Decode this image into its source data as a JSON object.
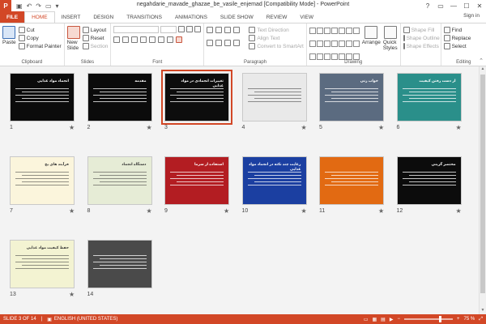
{
  "app": {
    "logo": "P",
    "title": "negahdarie_mavade_ghazae_be_vasile_enjemad [Compatibility Mode] - PowerPoint",
    "window_controls": [
      "?",
      "▭",
      "—",
      "☐",
      "✕"
    ],
    "sign_in": "Sign in"
  },
  "tabs": [
    {
      "label": "FILE"
    },
    {
      "label": "HOME"
    },
    {
      "label": "INSERT"
    },
    {
      "label": "DESIGN"
    },
    {
      "label": "TRANSITIONS"
    },
    {
      "label": "ANIMATIONS"
    },
    {
      "label": "SLIDE SHOW"
    },
    {
      "label": "REVIEW"
    },
    {
      "label": "VIEW"
    }
  ],
  "ribbon": {
    "clipboard": {
      "label": "Clipboard",
      "paste": "Paste",
      "cut": "Cut",
      "copy": "Copy",
      "format_painter": "Format Painter"
    },
    "slides": {
      "label": "Slides",
      "new_slide": "New Slide",
      "layout": "Layout",
      "reset": "Reset",
      "section": "Section"
    },
    "font": {
      "label": "Font"
    },
    "paragraph": {
      "label": "Paragraph",
      "text_direction": "Text Direction",
      "align_text": "Align Text",
      "convert": "Convert to SmartArt"
    },
    "drawing": {
      "label": "Drawing",
      "arrange": "Arrange",
      "quick_styles": "Quick Styles",
      "shape_fill": "Shape Fill",
      "shape_outline": "Shape Outline",
      "shape_effects": "Shape Effects"
    },
    "editing": {
      "label": "Editing",
      "find": "Find",
      "replace": "Replace",
      "select": "Select"
    }
  },
  "slides": [
    {
      "num": "1",
      "title": "انجماد مواد غذایی",
      "bg": "#0b0b0b",
      "star": "★"
    },
    {
      "num": "2",
      "title": "مقدمه",
      "bg": "#0b0b0b",
      "star": "★"
    },
    {
      "num": "3",
      "title": "تغییرات انجمادی در مواد غذایی",
      "bg": "#0d0d0d",
      "star": ""
    },
    {
      "num": "4",
      "title": "",
      "bg": "#e9e9e9",
      "star": "★"
    },
    {
      "num": "5",
      "title": "خواب زنی",
      "bg": "#5b6b80",
      "star": "★"
    },
    {
      "num": "6",
      "title": "از دست رفتن کیفیت",
      "bg": "#2a8f8a",
      "star": "★"
    },
    {
      "num": "7",
      "title": "فرآیند های یخ",
      "bg": "#fbf5dc",
      "star": "★"
    },
    {
      "num": "8",
      "title": "دستگاه انجماد",
      "bg": "#e6ecd6",
      "star": "★"
    },
    {
      "num": "9",
      "title": "استفاده از سرما",
      "bg": "#b31d22",
      "star": "★"
    },
    {
      "num": "10",
      "title": "رعایت چند نکته در انجماد مواد غذایی",
      "bg": "#1b3fa1",
      "star": "★"
    },
    {
      "num": "11",
      "title": "",
      "bg": "#e26a12",
      "star": "★"
    },
    {
      "num": "12",
      "title": "مختصر گزینی",
      "bg": "#0c0c0c",
      "star": "★"
    },
    {
      "num": "13",
      "title": "حفظ کیفیت مواد غذایی",
      "bg": "#f3f3d2",
      "star": "★"
    },
    {
      "num": "14",
      "title": "",
      "bg": "#4a4a4a",
      "star": ""
    }
  ],
  "status": {
    "slide": "SLIDE 3 OF 14",
    "language": "ENGLISH (UNITED STATES)",
    "zoom": "75 %",
    "zoom_level": 0.75
  }
}
